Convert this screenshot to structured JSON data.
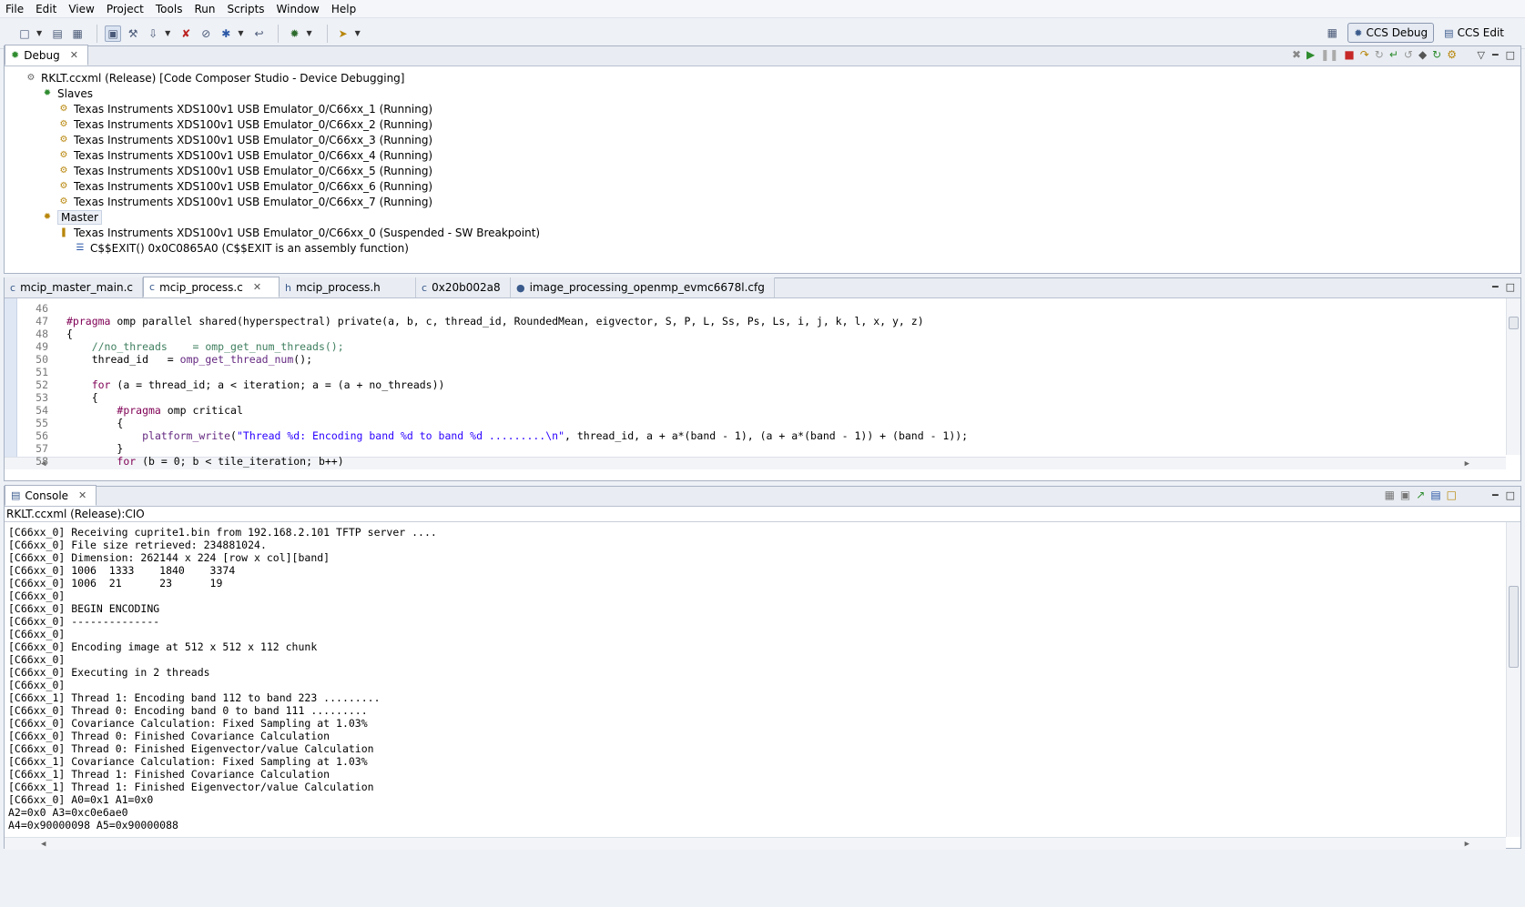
{
  "menu": [
    "File",
    "Edit",
    "View",
    "Project",
    "Tools",
    "Run",
    "Scripts",
    "Window",
    "Help"
  ],
  "perspectives": {
    "debug": "CCS Debug",
    "edit": "CCS Edit"
  },
  "debug_view": {
    "tab_label": "Debug",
    "root": "RKLT.ccxml (Release) [Code Composer Studio - Device Debugging]",
    "slaves_label": "Slaves",
    "slaves": [
      "Texas Instruments XDS100v1 USB Emulator_0/C66xx_1 (Running)",
      "Texas Instruments XDS100v1 USB Emulator_0/C66xx_2 (Running)",
      "Texas Instruments XDS100v1 USB Emulator_0/C66xx_3 (Running)",
      "Texas Instruments XDS100v1 USB Emulator_0/C66xx_4 (Running)",
      "Texas Instruments XDS100v1 USB Emulator_0/C66xx_5 (Running)",
      "Texas Instruments XDS100v1 USB Emulator_0/C66xx_6 (Running)",
      "Texas Instruments XDS100v1 USB Emulator_0/C66xx_7 (Running)"
    ],
    "master_label": "Master",
    "master_core": "Texas Instruments XDS100v1 USB Emulator_0/C66xx_0 (Suspended - SW Breakpoint)",
    "frame": "C$$EXIT() 0x0C0865A0  (C$$EXIT is an assembly function)"
  },
  "editor": {
    "tabs": [
      "mcip_master_main.c",
      "mcip_process.c",
      "mcip_process.h",
      "0x20b002a8",
      "image_processing_openmp_evmc6678l.cfg"
    ],
    "active_tab": "mcip_process.c",
    "lines": [
      {
        "n": "46",
        "indent": 0,
        "parts": []
      },
      {
        "n": "47",
        "indent": 0,
        "parts": [
          {
            "t": "#pragma",
            "c": "kw"
          },
          {
            "t": " omp parallel shared(hyperspectral) private(a, b, c, thread_id, RoundedMean, eigvector, S, P, L, Ss, Ps, Ls, i, j, k, l, x, y, z)",
            "c": ""
          }
        ]
      },
      {
        "n": "48",
        "indent": 0,
        "parts": [
          {
            "t": "{",
            "c": ""
          }
        ]
      },
      {
        "n": "49",
        "indent": 1,
        "parts": [
          {
            "t": "//no_threads    = omp_get_num_threads();",
            "c": "cm"
          }
        ]
      },
      {
        "n": "50",
        "indent": 1,
        "parts": [
          {
            "t": "thread_id   = ",
            "c": ""
          },
          {
            "t": "omp_get_thread_num",
            "c": "fn"
          },
          {
            "t": "();",
            "c": ""
          }
        ]
      },
      {
        "n": "51",
        "indent": 0,
        "parts": []
      },
      {
        "n": "52",
        "indent": 1,
        "parts": [
          {
            "t": "for",
            "c": "kw"
          },
          {
            "t": " (a = thread_id; a < iteration; a = (a + no_threads))",
            "c": ""
          }
        ]
      },
      {
        "n": "53",
        "indent": 1,
        "parts": [
          {
            "t": "{",
            "c": ""
          }
        ]
      },
      {
        "n": "54",
        "indent": 2,
        "parts": [
          {
            "t": "#pragma",
            "c": "kw"
          },
          {
            "t": " omp critical",
            "c": ""
          }
        ]
      },
      {
        "n": "55",
        "indent": 2,
        "parts": [
          {
            "t": "{",
            "c": ""
          }
        ]
      },
      {
        "n": "56",
        "indent": 3,
        "parts": [
          {
            "t": "platform_write",
            "c": "fn"
          },
          {
            "t": "(",
            "c": ""
          },
          {
            "t": "\"Thread %d: Encoding band %d to band %d .........\\n\"",
            "c": "st"
          },
          {
            "t": ", thread_id, a + a*(band - 1), (a + a*(band - 1)) + (band - 1));",
            "c": ""
          }
        ]
      },
      {
        "n": "57",
        "indent": 2,
        "parts": [
          {
            "t": "}",
            "c": ""
          }
        ]
      },
      {
        "n": "58",
        "indent": 2,
        "parts": [
          {
            "t": "for",
            "c": "kw"
          },
          {
            "t": " (b = 0; b < tile_iteration; b++)",
            "c": ""
          }
        ]
      }
    ]
  },
  "console": {
    "tab_label": "Console",
    "subtitle": "RKLT.ccxml (Release):CIO",
    "lines": [
      "[C66xx_0] Receiving cuprite1.bin from 192.168.2.101 TFTP server ....",
      "[C66xx_0] File size retrieved: 234881024.",
      "[C66xx_0] Dimension: 262144 x 224 [row x col][band]",
      "[C66xx_0] 1006  1333    1840    3374",
      "[C66xx_0] 1006  21      23      19",
      "[C66xx_0]",
      "[C66xx_0] BEGIN ENCODING",
      "[C66xx_0] --------------",
      "[C66xx_0]",
      "[C66xx_0] Encoding image at 512 x 512 x 112 chunk",
      "[C66xx_0]",
      "[C66xx_0] Executing in 2 threads",
      "[C66xx_0]",
      "[C66xx_1] Thread 1: Encoding band 112 to band 223 .........",
      "[C66xx_0] Thread 0: Encoding band 0 to band 111 .........",
      "[C66xx_0] Covariance Calculation: Fixed Sampling at 1.03%",
      "[C66xx_0] Thread 0: Finished Covariance Calculation",
      "[C66xx_0] Thread 0: Finished Eigenvector/value Calculation",
      "[C66xx_1] Covariance Calculation: Fixed Sampling at 1.03%",
      "[C66xx_1] Thread 1: Finished Covariance Calculation",
      "[C66xx_1] Thread 1: Finished Eigenvector/value Calculation",
      "[C66xx_0] A0=0x1 A1=0x0",
      "A2=0x0 A3=0xc0e6ae0",
      "A4=0x90000098 A5=0x90000088"
    ]
  }
}
